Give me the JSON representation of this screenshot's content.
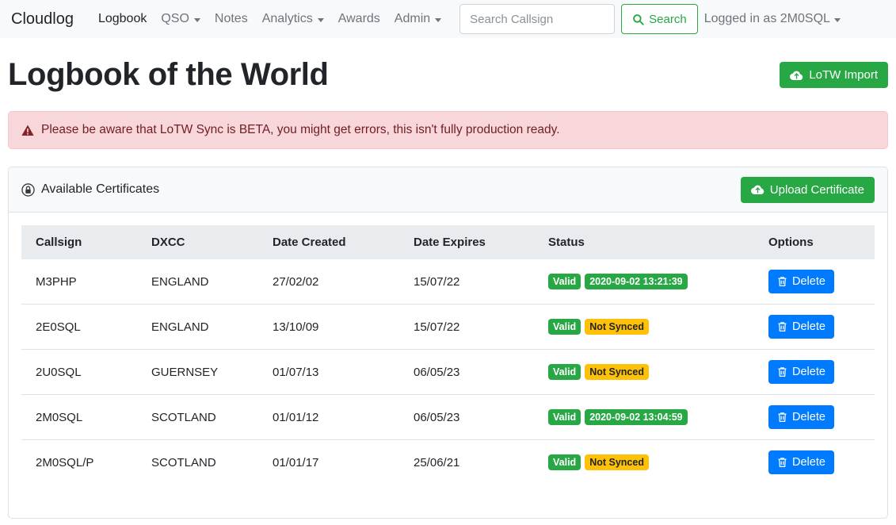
{
  "navbar": {
    "brand": "Cloudlog",
    "items": [
      {
        "label": "Logbook",
        "dropdown": false,
        "active": true
      },
      {
        "label": "QSO",
        "dropdown": true,
        "active": false
      },
      {
        "label": "Notes",
        "dropdown": false,
        "active": false
      },
      {
        "label": "Analytics",
        "dropdown": true,
        "active": false
      },
      {
        "label": "Awards",
        "dropdown": false,
        "active": false
      },
      {
        "label": "Admin",
        "dropdown": true,
        "active": false
      }
    ],
    "search": {
      "placeholder": "Search Callsign",
      "value": "",
      "button_label": "Search",
      "icon": "search-icon"
    },
    "user_menu": {
      "label": "Logged in as 2M0SQL",
      "icon": "caret-down-icon"
    }
  },
  "header": {
    "title": "Logbook of the World",
    "import_button": {
      "label": "LoTW Import",
      "icon": "cloud-upload-icon",
      "color": "#28a745"
    }
  },
  "alert": {
    "icon": "warning-triangle-icon",
    "text": "Please be aware that LoTW Sync is BETA, you might get errors, this isn't fully production ready.",
    "background": "#f8d7da",
    "text_color": "#721c24"
  },
  "card": {
    "header": {
      "icon": "certificate-lock-icon",
      "title": "Available Certificates",
      "upload_button": {
        "label": "Upload Certificate",
        "icon": "cloud-upload-icon",
        "color": "#28a745"
      }
    },
    "table": {
      "columns": [
        "Callsign",
        "DXCC",
        "Date Created",
        "Date Expires",
        "Status",
        "Options"
      ],
      "rows": [
        {
          "callsign": "M3PHP",
          "dxcc": "ENGLAND",
          "date_created": "27/02/02",
          "date_expires": "15/07/22",
          "status_badges": [
            {
              "label": "Valid",
              "style": "success"
            },
            {
              "label": "2020-09-02 13:21:39",
              "style": "success"
            }
          ],
          "action": {
            "label": "Delete",
            "icon": "trash-icon",
            "color": "#007bff"
          }
        },
        {
          "callsign": "2E0SQL",
          "dxcc": "ENGLAND",
          "date_created": "13/10/09",
          "date_expires": "15/07/22",
          "status_badges": [
            {
              "label": "Valid",
              "style": "success"
            },
            {
              "label": "Not Synced",
              "style": "warning"
            }
          ],
          "action": {
            "label": "Delete",
            "icon": "trash-icon",
            "color": "#007bff"
          }
        },
        {
          "callsign": "2U0SQL",
          "dxcc": "GUERNSEY",
          "date_created": "01/07/13",
          "date_expires": "06/05/23",
          "status_badges": [
            {
              "label": "Valid",
              "style": "success"
            },
            {
              "label": "Not Synced",
              "style": "warning"
            }
          ],
          "action": {
            "label": "Delete",
            "icon": "trash-icon",
            "color": "#007bff"
          }
        },
        {
          "callsign": "2M0SQL",
          "dxcc": "SCOTLAND",
          "date_created": "01/01/12",
          "date_expires": "06/05/23",
          "status_badges": [
            {
              "label": "Valid",
              "style": "success"
            },
            {
              "label": "2020-09-02 13:04:59",
              "style": "success"
            }
          ],
          "action": {
            "label": "Delete",
            "icon": "trash-icon",
            "color": "#007bff"
          }
        },
        {
          "callsign": "2M0SQL/P",
          "dxcc": "SCOTLAND",
          "date_created": "01/01/17",
          "date_expires": "25/06/21",
          "status_badges": [
            {
              "label": "Valid",
              "style": "success"
            },
            {
              "label": "Not Synced",
              "style": "warning"
            }
          ],
          "action": {
            "label": "Delete",
            "icon": "trash-icon",
            "color": "#007bff"
          }
        }
      ]
    }
  }
}
